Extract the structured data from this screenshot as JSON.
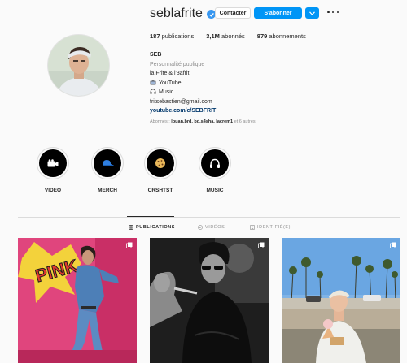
{
  "profile": {
    "username": "seblafrite",
    "contact_label": "Contacter",
    "follow_label": "S'abonner"
  },
  "stats": {
    "posts": "187",
    "posts_label": "publications",
    "followers": "3,1M",
    "followers_label": "abonnés",
    "following": "879",
    "following_label": "abonnements"
  },
  "bio": {
    "name": "SEB",
    "category": "Personnalité publique",
    "line1": "la Frite & l'3afrit",
    "youtube": "YouTube",
    "music": "Music",
    "email": "fritsebastien@gmail.com",
    "link": "youtube.com/c/SEBFRIT",
    "followed_prefix": "Abonnés : ",
    "followed_names": "louan.brd, bd.s4sha, lacrem1",
    "followed_suffix": " et 6 autres"
  },
  "highlights": [
    {
      "label": "VIDEO",
      "icon": "video-camera-icon"
    },
    {
      "label": "MERCH",
      "icon": "cap-icon"
    },
    {
      "label": "CRSHTST",
      "icon": "cookie-icon"
    },
    {
      "label": "MUSIC",
      "icon": "headphones-icon"
    }
  ],
  "tabs": [
    {
      "label": "PUBLICATIONS",
      "icon": "grid-icon",
      "active": true
    },
    {
      "label": "VIDÉOS",
      "icon": "play-icon",
      "active": false
    },
    {
      "label": "IDENTIFIÉ(E)",
      "icon": "tag-icon",
      "active": false
    }
  ],
  "posts": [
    {
      "kind": "photo",
      "multi": true,
      "text": "PINK"
    },
    {
      "kind": "photo",
      "multi": true
    },
    {
      "kind": "photo",
      "multi": true
    }
  ],
  "colors": {
    "accent": "#0095f6",
    "verified": "#3897f0",
    "link": "#00376b"
  }
}
